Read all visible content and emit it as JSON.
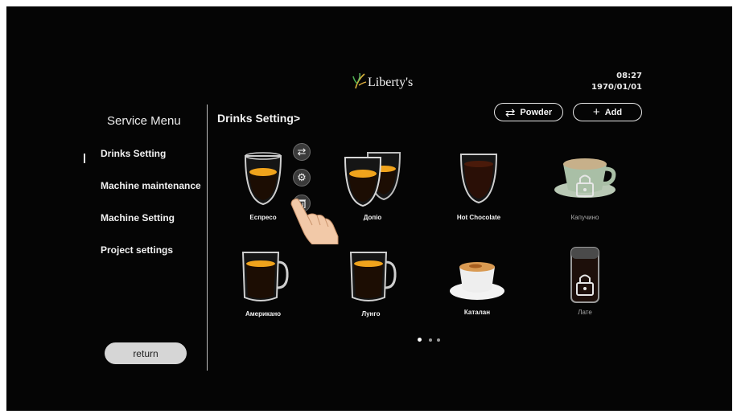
{
  "header": {
    "logo_text": "Liberty's",
    "time": "08:27",
    "date": "1970/01/01"
  },
  "sidebar": {
    "title": "Service Menu",
    "items": [
      {
        "label": "Drinks Setting",
        "active": true
      },
      {
        "label": "Machine maintenance",
        "active": false
      },
      {
        "label": "Machine Setting",
        "active": false
      },
      {
        "label": "Project settings",
        "active": false
      }
    ],
    "return_label": "return"
  },
  "main": {
    "title": "Drinks Setting>",
    "powder_label": "Powder",
    "add_label": "Add",
    "drinks": [
      {
        "name": "Еспресо",
        "icon": "espresso-glass-icon",
        "locked": false
      },
      {
        "name": "Допіо",
        "icon": "double-espresso-glasses-icon",
        "locked": false
      },
      {
        "name": "Hot Chocolate",
        "icon": "hot-chocolate-glass-icon",
        "locked": false
      },
      {
        "name": "Капучино",
        "icon": "cappuccino-cup-icon",
        "locked": true
      },
      {
        "name": "Американо",
        "icon": "americano-mug-icon",
        "locked": false
      },
      {
        "name": "Лунго",
        "icon": "lungo-mug-icon",
        "locked": false
      },
      {
        "name": "Каталан",
        "icon": "catalan-cup-icon",
        "locked": false
      },
      {
        "name": "Лате",
        "icon": "latte-glass-icon",
        "locked": true
      }
    ],
    "page_count": 3,
    "active_page": 1
  },
  "colors": {
    "background": "#050505",
    "text": "#f0f0f0",
    "locked_text": "#a8a8a8",
    "crema": "#f0a31c",
    "return_button": "#d6d6d6"
  }
}
